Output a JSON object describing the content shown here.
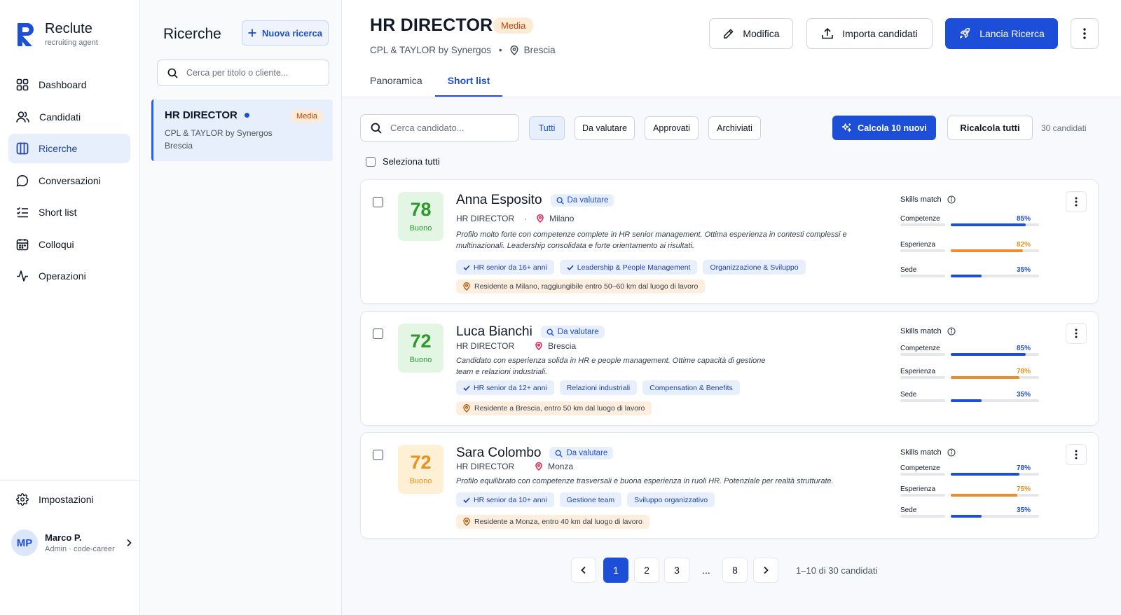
{
  "brand": {
    "name": "Reclute",
    "subtitle": "recruiting agent"
  },
  "nav": {
    "items": [
      {
        "label": "Dashboard",
        "icon": "grid-icon",
        "active": false
      },
      {
        "label": "Candidati",
        "icon": "users-icon",
        "active": false
      },
      {
        "label": "Ricerche",
        "icon": "columns-icon",
        "active": true
      },
      {
        "label": "Conversazioni",
        "icon": "chat-icon",
        "active": false
      },
      {
        "label": "Short list",
        "icon": "list-check-icon",
        "active": false
      },
      {
        "label": "Colloqui",
        "icon": "calendar-icon",
        "active": false
      },
      {
        "label": "Operazioni",
        "icon": "activity-icon",
        "active": false
      }
    ],
    "settings": "Impostazioni"
  },
  "user": {
    "initials": "MP",
    "name": "Marco P.",
    "role": "Admin · code-career"
  },
  "searches": {
    "title": "Ricerche",
    "new_label": "Nuova ricerca",
    "search_placeholder": "Cerca per titolo o cliente...",
    "selected": {
      "title": "HR DIRECTOR",
      "priority": "Media",
      "client": "CPL & TAYLOR by Synergos",
      "city": "Brescia"
    }
  },
  "header": {
    "title": "HR DIRECTOR",
    "priority": "Media",
    "client": "CPL & TAYLOR by Synergos",
    "separator": "•",
    "city": "Brescia",
    "edit_label": "Modifica",
    "import_label": "Importa candidati",
    "launch_label": "Lancia Ricerca",
    "tabs": [
      "Panoramica",
      "Short list"
    ]
  },
  "filters": {
    "search_placeholder": "Cerca candidato...",
    "chips": [
      "Tutti",
      "Da valutare",
      "Approvati",
      "Archiviati"
    ],
    "calc_label": "Calcola 10 nuovi",
    "recalc_label": "Ricalcola tutti",
    "count": "30 candidati",
    "select_all": "Seleziona tutti"
  },
  "colors": {
    "accent": "#1d4ed8",
    "orange_bar": "#f28c28",
    "score_green": "#2e9a2e",
    "score_amber": "#e8901a",
    "location_pin": "#e11d48"
  },
  "candidates": [
    {
      "score": "78",
      "score_label": "Buono",
      "score_tone": "green",
      "name": "Anna Esposito",
      "status": "Da valutare",
      "role": "HR DIRECTOR",
      "city": "Milano",
      "desc_lines": [
        "Profilo molto forte con competenze complete in HR senior management. Ottima esperienza in contesti complessi e",
        "multinazionali. Leadership consolidata e forte orientamento ai risultati."
      ],
      "tags": [
        {
          "label": "HR senior da 16+ anni",
          "check": true
        },
        {
          "label": "Leadership & People Management",
          "check": true
        },
        {
          "label": "Organizzazione & Sviluppo",
          "check": false
        }
      ],
      "location_note": "Residente a Milano, raggiungibile entro 50–60 km dal luogo di lavoro",
      "skills_title": "Skills match",
      "skills": [
        {
          "label": "Competenze",
          "pct": "85%",
          "value": 0.85,
          "color": "#1d4ed8"
        },
        {
          "label": "Esperienza",
          "pct": "82%",
          "value": 0.82,
          "color": "#f28c28"
        },
        {
          "label": "Sede",
          "pct": "35%",
          "value": 0.35,
          "color": "#1d4ed8"
        }
      ]
    },
    {
      "score": "72",
      "score_label": "Buono",
      "score_tone": "green",
      "name": "Luca Bianchi",
      "status": "Da valutare",
      "role": "HR DIRECTOR",
      "city": "Brescia",
      "desc_lines": [
        "Candidato con esperienza solida in HR e people management. Ottime capacità di gestione",
        "team e relazioni industriali."
      ],
      "tags": [
        {
          "label": "HR senior da 12+ anni",
          "check": true
        },
        {
          "label": "Relazioni industriali",
          "check": false
        },
        {
          "label": "Compensation & Benefits",
          "check": false
        }
      ],
      "location_note": "Residente a Brescia, entro 50 km dal luogo di lavoro",
      "skills_title": "Skills match",
      "skills": [
        {
          "label": "Competenze",
          "pct": "85%",
          "value": 0.85,
          "color": "#1d4ed8"
        },
        {
          "label": "Esperienza",
          "pct": "78%",
          "value": 0.78,
          "color": "#f28c28"
        },
        {
          "label": "Sede",
          "pct": "35%",
          "value": 0.35,
          "color": "#1d4ed8"
        }
      ]
    },
    {
      "score": "72",
      "score_label": "Buono",
      "score_tone": "amber",
      "name": "Sara Colombo",
      "status": "Da valutare",
      "role": "HR DIRECTOR",
      "city": "Monza",
      "desc_lines": [
        "Profilo equilibrato con competenze trasversali e buona esperienza in ruoli HR. Potenziale per realtà strutturate."
      ],
      "tags": [
        {
          "label": "HR senior da 10+ anni",
          "check": true
        },
        {
          "label": "Gestione team",
          "check": false
        },
        {
          "label": "Sviluppo organizzativo",
          "check": false
        }
      ],
      "location_note": "Residente a Monza, entro 40 km dal luogo di lavoro",
      "skills_title": "Skills match",
      "skills": [
        {
          "label": "Competenze",
          "pct": "78%",
          "value": 0.78,
          "color": "#1d4ed8"
        },
        {
          "label": "Esperienza",
          "pct": "75%",
          "value": 0.75,
          "color": "#f28c28"
        },
        {
          "label": "Sede",
          "pct": "35%",
          "value": 0.35,
          "color": "#1d4ed8"
        }
      ]
    }
  ],
  "pagination": {
    "pages": [
      "1",
      "2",
      "3",
      "...",
      "8"
    ],
    "current": "1",
    "info": "1–10 di 30 candidati"
  }
}
